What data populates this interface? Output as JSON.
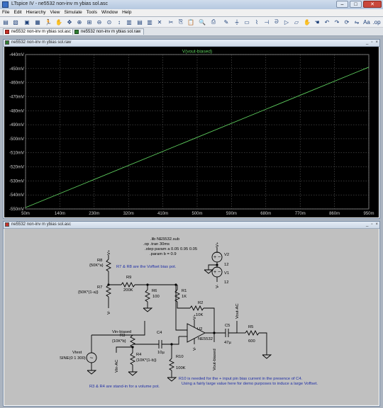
{
  "window": {
    "title": "LTspice IV - ne5532 non-inv m ybias sol.asc"
  },
  "menu": [
    "File",
    "Edit",
    "Hierarchy",
    "View",
    "Simulate",
    "Tools",
    "Window",
    "Help"
  ],
  "tabs": [
    {
      "label": "ne5532 non-inv m ybias sol.asc",
      "active": true
    },
    {
      "label": "ne5532 non-inv m ybias sol.raw",
      "active": false
    }
  ],
  "plot_window": {
    "title": "ne5532 non-inv m ybias sol.raw"
  },
  "schematic_window": {
    "title": "ne5532 non-inv m ybias sol.asc"
  },
  "chart_data": {
    "type": "line",
    "title": "V(vout-biased)",
    "x_ticks": [
      "50m",
      "140m",
      "230m",
      "320m",
      "410m",
      "500m",
      "590m",
      "680m",
      "770m",
      "860m",
      "950m"
    ],
    "y_ticks": [
      "-440mV",
      "-450mV",
      "-460mV",
      "-470mV",
      "-480mV",
      "-490mV",
      "-500mV",
      "-510mV",
      "-520mV",
      "-530mV",
      "-540mV",
      "-550mV"
    ],
    "xlim": [
      0.05,
      0.95
    ],
    "ylim": [
      -0.55,
      -0.44
    ],
    "grid": true,
    "series": [
      {
        "name": "V(vout-biased)",
        "color": "#5fd05f",
        "x": [
          0.05,
          0.95
        ],
        "y": [
          -0.549,
          -0.449
        ]
      }
    ]
  },
  "schematic": {
    "directives": [
      ".lib NE5532.sub",
      ".op .tran 30ms",
      ".step param a 0.05 0.95 0.05",
      ".param b = 0.9"
    ],
    "notes": {
      "bias": "R7 & R8 are the Voffset bias pot.",
      "volume": "R3 & R4 are stand-in for a volume pot.",
      "r10_line1": "R10 is needed for the + input pin bias current in the presence of C4.",
      "r10_line2": "Using a fairly large value here for demo purposes to induce a large Voffset."
    },
    "components": {
      "R8": {
        "ref": "R8",
        "value": "{50K*a}"
      },
      "R7": {
        "ref": "R7",
        "value": "{50K*(1-a)}"
      },
      "R9": {
        "ref": "R9",
        "value": "200K"
      },
      "R6": {
        "ref": "R6",
        "value": "100"
      },
      "R1": {
        "ref": "R1",
        "value": "1K"
      },
      "R2": {
        "ref": "R2",
        "value": "10K"
      },
      "R3": {
        "ref": "R3",
        "value": "{10K*b}"
      },
      "R4": {
        "ref": "R4",
        "value": "{10K*(1-b)}"
      },
      "C4": {
        "ref": "C4",
        "value": "10µ"
      },
      "R10": {
        "ref": "R10",
        "value": "100K"
      },
      "C5": {
        "ref": "C5",
        "value": "47µ"
      },
      "R5": {
        "ref": "R5",
        "value": "600"
      },
      "U2": {
        "ref": "U2",
        "value": "NE5532"
      },
      "V2": {
        "ref": "V2",
        "value": "12"
      },
      "V1": {
        "ref": "V1",
        "value": "12"
      },
      "Vtest": {
        "ref": "Vtest",
        "value": "SINE(0 1 300)"
      }
    },
    "labels": {
      "vplus": "V+",
      "vminus": "V-",
      "vin_biased": "Vin-biased",
      "vin_ac": "Vin-AC",
      "vout_biased": "Vout-biased",
      "vout_ac": "Vout-AC"
    }
  }
}
